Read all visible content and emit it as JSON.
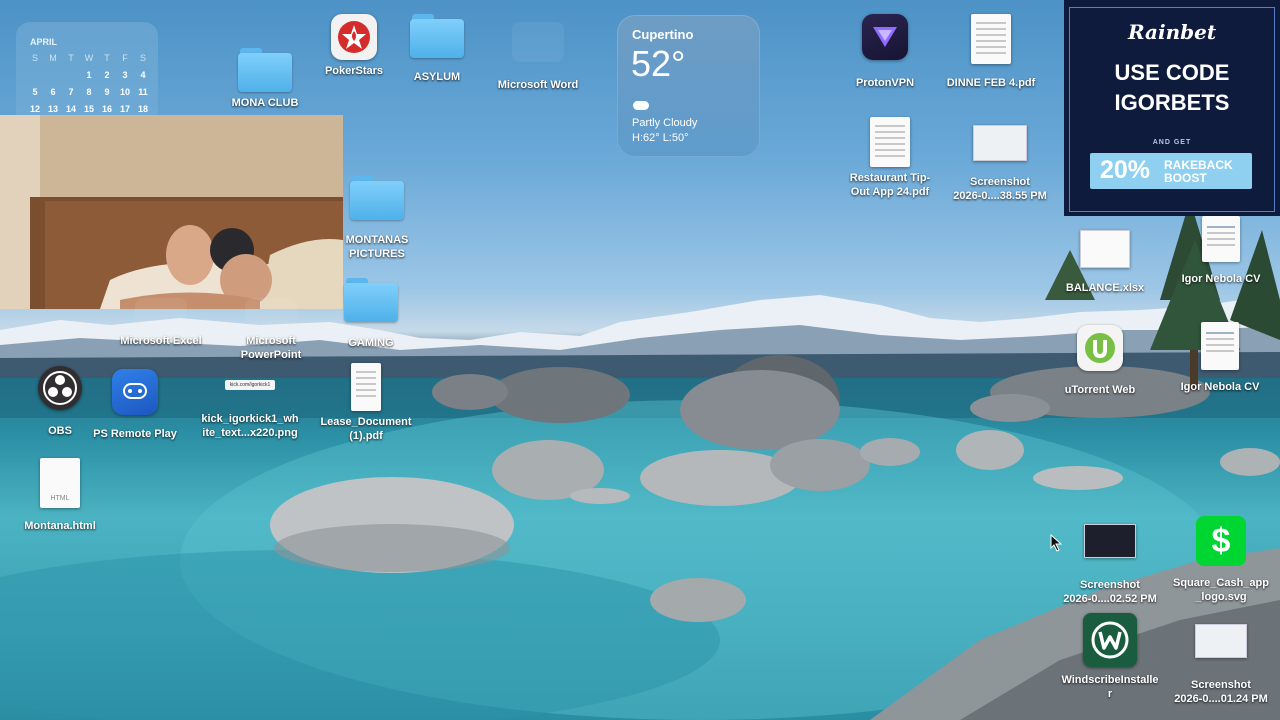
{
  "calendar": {
    "month": "APRIL",
    "weekdays": [
      "S",
      "M",
      "T",
      "W",
      "T",
      "F",
      "S"
    ],
    "rows": [
      [
        "",
        "",
        "",
        "1",
        "2",
        "3",
        "4"
      ],
      [
        "5",
        "6",
        "7",
        "8",
        "9",
        "10",
        "11"
      ],
      [
        "12",
        "13",
        "14",
        "15",
        "16",
        "17",
        "18"
      ]
    ]
  },
  "weather": {
    "city": "Cupertino",
    "temp": "52°",
    "condition": "Partly Cloudy",
    "range": "H:62° L:50°"
  },
  "ad": {
    "brand": "Rainbet",
    "headline_line1": "USE CODE",
    "headline_line2": "IGORBETS",
    "subline": "AND GET",
    "offer_percent": "20%",
    "offer_line1": "RAKEBACK",
    "offer_line2": "BOOST"
  },
  "thumb_small_text": "kick.com/igorkick1",
  "icons": {
    "mona_club": "MONA CLUB",
    "pokerstars": "PokerStars",
    "asylum": "ASYLUM",
    "word": "Microsoft Word",
    "protonvpn": "ProtonVPN",
    "dinne_pdf": "DINNE FEB 4.pdf",
    "restaurant_pdf": "Restaurant Tip-\nOut App 24.pdf",
    "screenshot1": "Screenshot\n2026-0....38.55 PM",
    "montanas_pictures": "MONTANAS\nPICTURES",
    "gaming": "GAMING",
    "excel": "Microsoft Excel",
    "powerpoint": "Microsoft\nPowerPoint",
    "obs": "OBS",
    "ps_remote": "PS Remote Play",
    "kick_png": "kick_igorkick1_wh\nite_text...x220.png",
    "lease_pdf": "Lease_Document\n(1).pdf",
    "montana_html": "Montana.html",
    "html_badge": "HTML",
    "balance": "BALANCE.xlsx",
    "igor_cv1": "Igor Nebola CV",
    "utorrent": "uTorrent Web",
    "igor_cv2": "Igor Nebola CV",
    "screenshot2": "Screenshot\n2026-0....02.52 PM",
    "square_cash": "Square_Cash_app\n_logo.svg",
    "windscribe": "WindscribeInstalle\nr",
    "screenshot3": "Screenshot\n2026-0....01.24 PM"
  },
  "colors": {
    "ad_bg": "#0f1b3d",
    "ad_offer": "#8fd0f0",
    "pokerstars_red": "#d42b2b",
    "proton": "#6d4aff",
    "utorrent": "#78c043",
    "windscribe": "#1a5c3e",
    "cash": "#00d632",
    "obs": "#302e31",
    "ps": "#2c6fd6"
  }
}
